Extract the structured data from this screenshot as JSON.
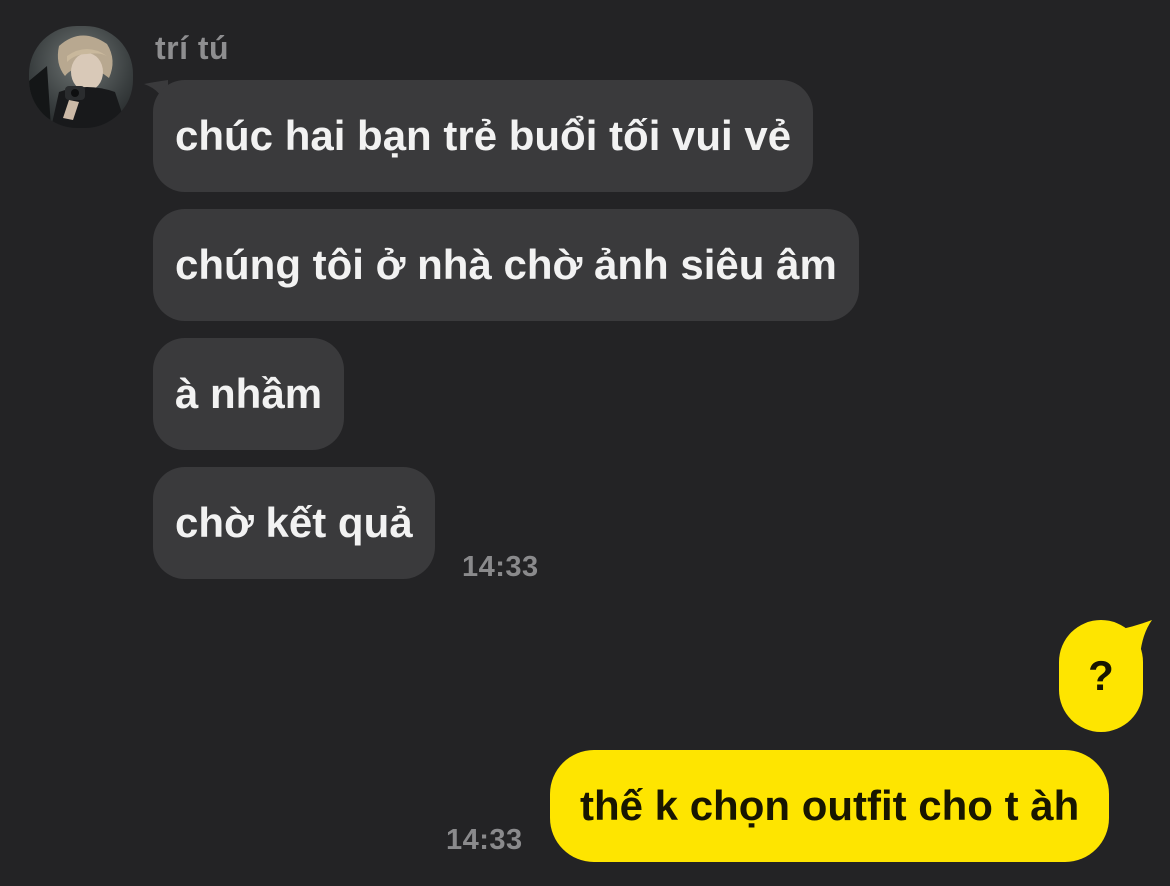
{
  "sender": {
    "name": "trí tú"
  },
  "incoming": [
    "chúc hai bạn trẻ buổi tối vui vẻ",
    "chúng tôi ở nhà chờ ảnh siêu âm",
    "à nhầm",
    "chờ kết quả"
  ],
  "incoming_time": "14:33",
  "outgoing": [
    "?",
    "thế k chọn outfit cho t àh"
  ],
  "outgoing_time": "14:33",
  "colors": {
    "background": "#232325",
    "incoming_bubble": "#3a3a3c",
    "outgoing_bubble": "#fee500",
    "timestamp": "#8a8a8c"
  }
}
